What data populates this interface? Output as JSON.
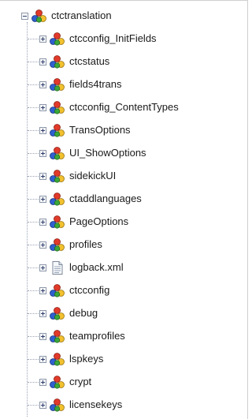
{
  "tree": {
    "root": {
      "label": "ctctranslation",
      "icon": "node-cluster-icon",
      "expanded": true
    },
    "children": [
      {
        "label": "ctcconfig_InitFields",
        "icon": "node-cluster-icon"
      },
      {
        "label": "ctcstatus",
        "icon": "node-cluster-icon"
      },
      {
        "label": "fields4trans",
        "icon": "node-cluster-icon"
      },
      {
        "label": "ctcconfig_ContentTypes",
        "icon": "node-cluster-icon"
      },
      {
        "label": "TransOptions",
        "icon": "node-cluster-icon"
      },
      {
        "label": "UI_ShowOptions",
        "icon": "node-cluster-icon"
      },
      {
        "label": "sidekickUI",
        "icon": "node-cluster-icon"
      },
      {
        "label": "ctaddlanguages",
        "icon": "node-cluster-icon"
      },
      {
        "label": "PageOptions",
        "icon": "node-cluster-icon"
      },
      {
        "label": "profiles",
        "icon": "node-cluster-icon"
      },
      {
        "label": "logback.xml",
        "icon": "file-icon"
      },
      {
        "label": "ctcconfig",
        "icon": "node-cluster-icon"
      },
      {
        "label": "debug",
        "icon": "node-cluster-icon"
      },
      {
        "label": "teamprofiles",
        "icon": "node-cluster-icon"
      },
      {
        "label": "lspkeys",
        "icon": "node-cluster-icon"
      },
      {
        "label": "crypt",
        "icon": "node-cluster-icon"
      },
      {
        "label": "licensekeys",
        "icon": "node-cluster-icon"
      }
    ]
  },
  "colors": {
    "node_red": "#e23a2a",
    "node_blue": "#2f5fd0",
    "node_yellow": "#f2c12e",
    "node_green": "#3aa83a",
    "connector": "#9aa3b5"
  }
}
